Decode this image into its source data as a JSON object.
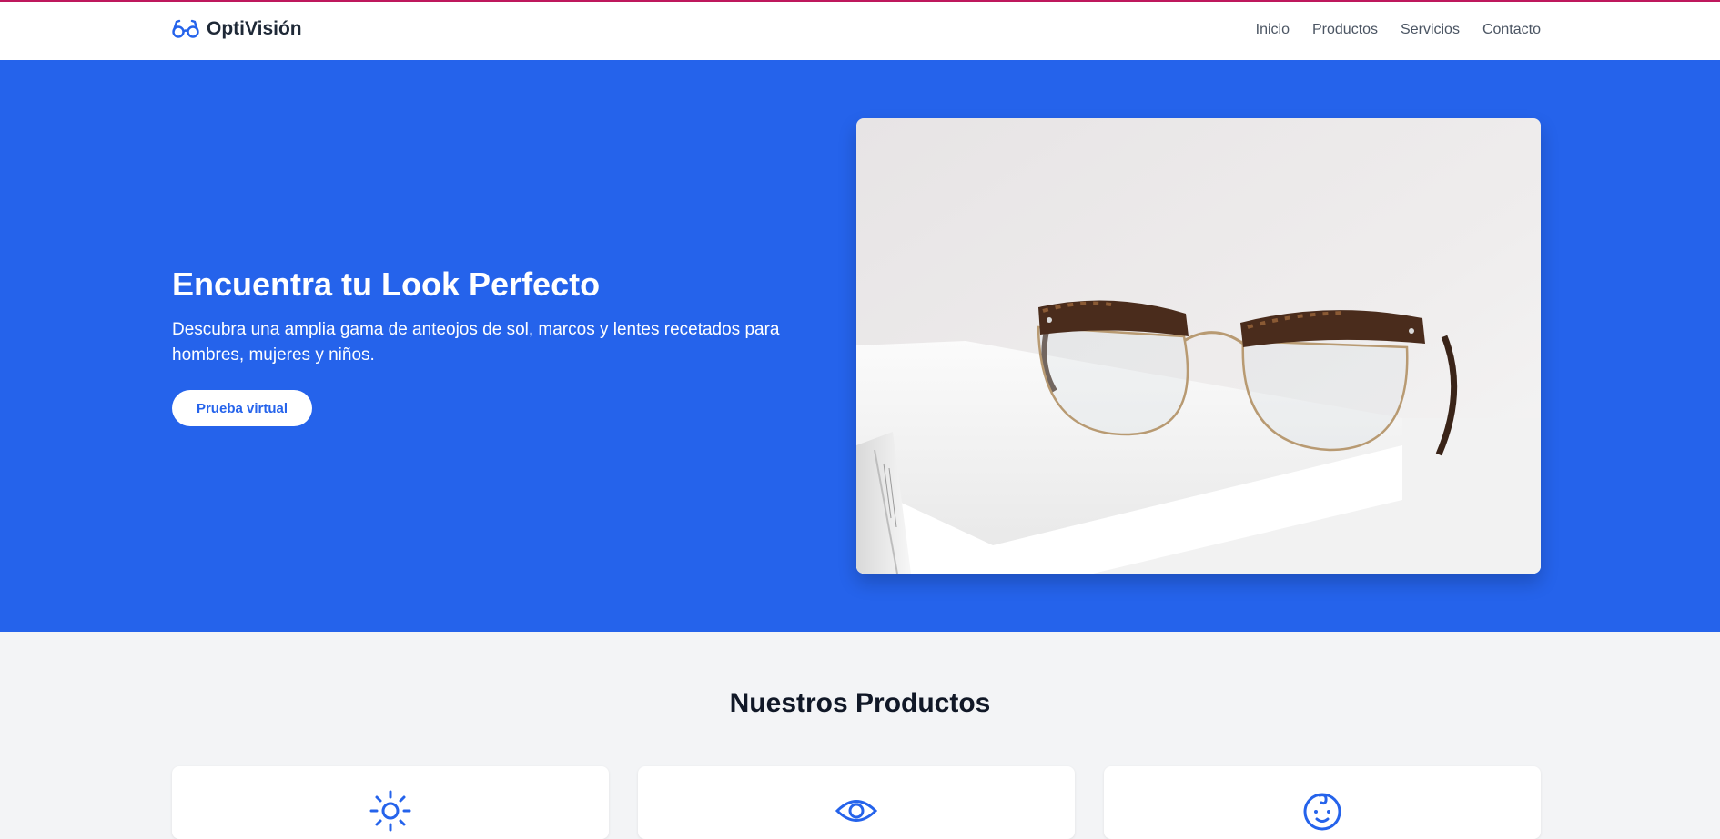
{
  "brand": {
    "name": "OptiVisión",
    "icon": "glasses-icon",
    "accent": "#2563eb"
  },
  "nav": {
    "items": [
      {
        "label": "Inicio"
      },
      {
        "label": "Productos"
      },
      {
        "label": "Servicios"
      },
      {
        "label": "Contacto"
      }
    ]
  },
  "hero": {
    "title": "Encuentra tu Look Perfecto",
    "description": "Descubra una amplia gama de anteojos de sol, marcos y lentes recetados para hombres, mujeres y niños.",
    "button_label": "Prueba virtual",
    "background": "#2563eb"
  },
  "products": {
    "title": "Nuestros Productos",
    "cards": [
      {
        "icon": "sun-icon"
      },
      {
        "icon": "eye-icon"
      },
      {
        "icon": "baby-face-icon"
      }
    ]
  }
}
